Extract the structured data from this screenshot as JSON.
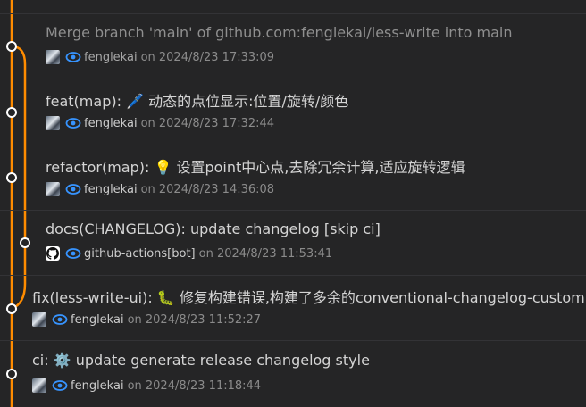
{
  "colors": {
    "background": "#252526",
    "graph_line": "#ff8c00",
    "eye_icon": "#3794ff"
  },
  "commits": [
    {
      "message": "Merge branch 'main' of github.com:fenglekai/less-write into main",
      "author": "fenglekai",
      "date": "on 2024/8/23 17:33:09",
      "avatar": "user-avatar",
      "dimmed": true
    },
    {
      "message": "feat(map): 🖊️ 动态的点位显示:位置/旋转/颜色",
      "author": "fenglekai",
      "date": "on 2024/8/23 17:32:44",
      "avatar": "user-avatar"
    },
    {
      "message": "refactor(map): 💡 设置point中心点,去除冗余计算,适应旋转逻辑",
      "author": "fenglekai",
      "date": "on 2024/8/23 14:36:08",
      "avatar": "user-avatar"
    },
    {
      "message": "docs(CHANGELOG): update changelog [skip ci]",
      "author": "github-actions[bot]",
      "date": "on 2024/8/23 11:53:41",
      "avatar": "github-icon"
    },
    {
      "message": "fix(less-write-ui): 🐛 修复构建错误,构建了多余的conventional-changelog-custom",
      "author": "fenglekai",
      "date": "on 2024/8/23 11:52:27",
      "avatar": "user-avatar"
    },
    {
      "message": "ci: ⚙️ update generate release changelog style",
      "author": "fenglekai",
      "date": "on 2024/8/23 11:18:44",
      "avatar": "user-avatar"
    }
  ]
}
